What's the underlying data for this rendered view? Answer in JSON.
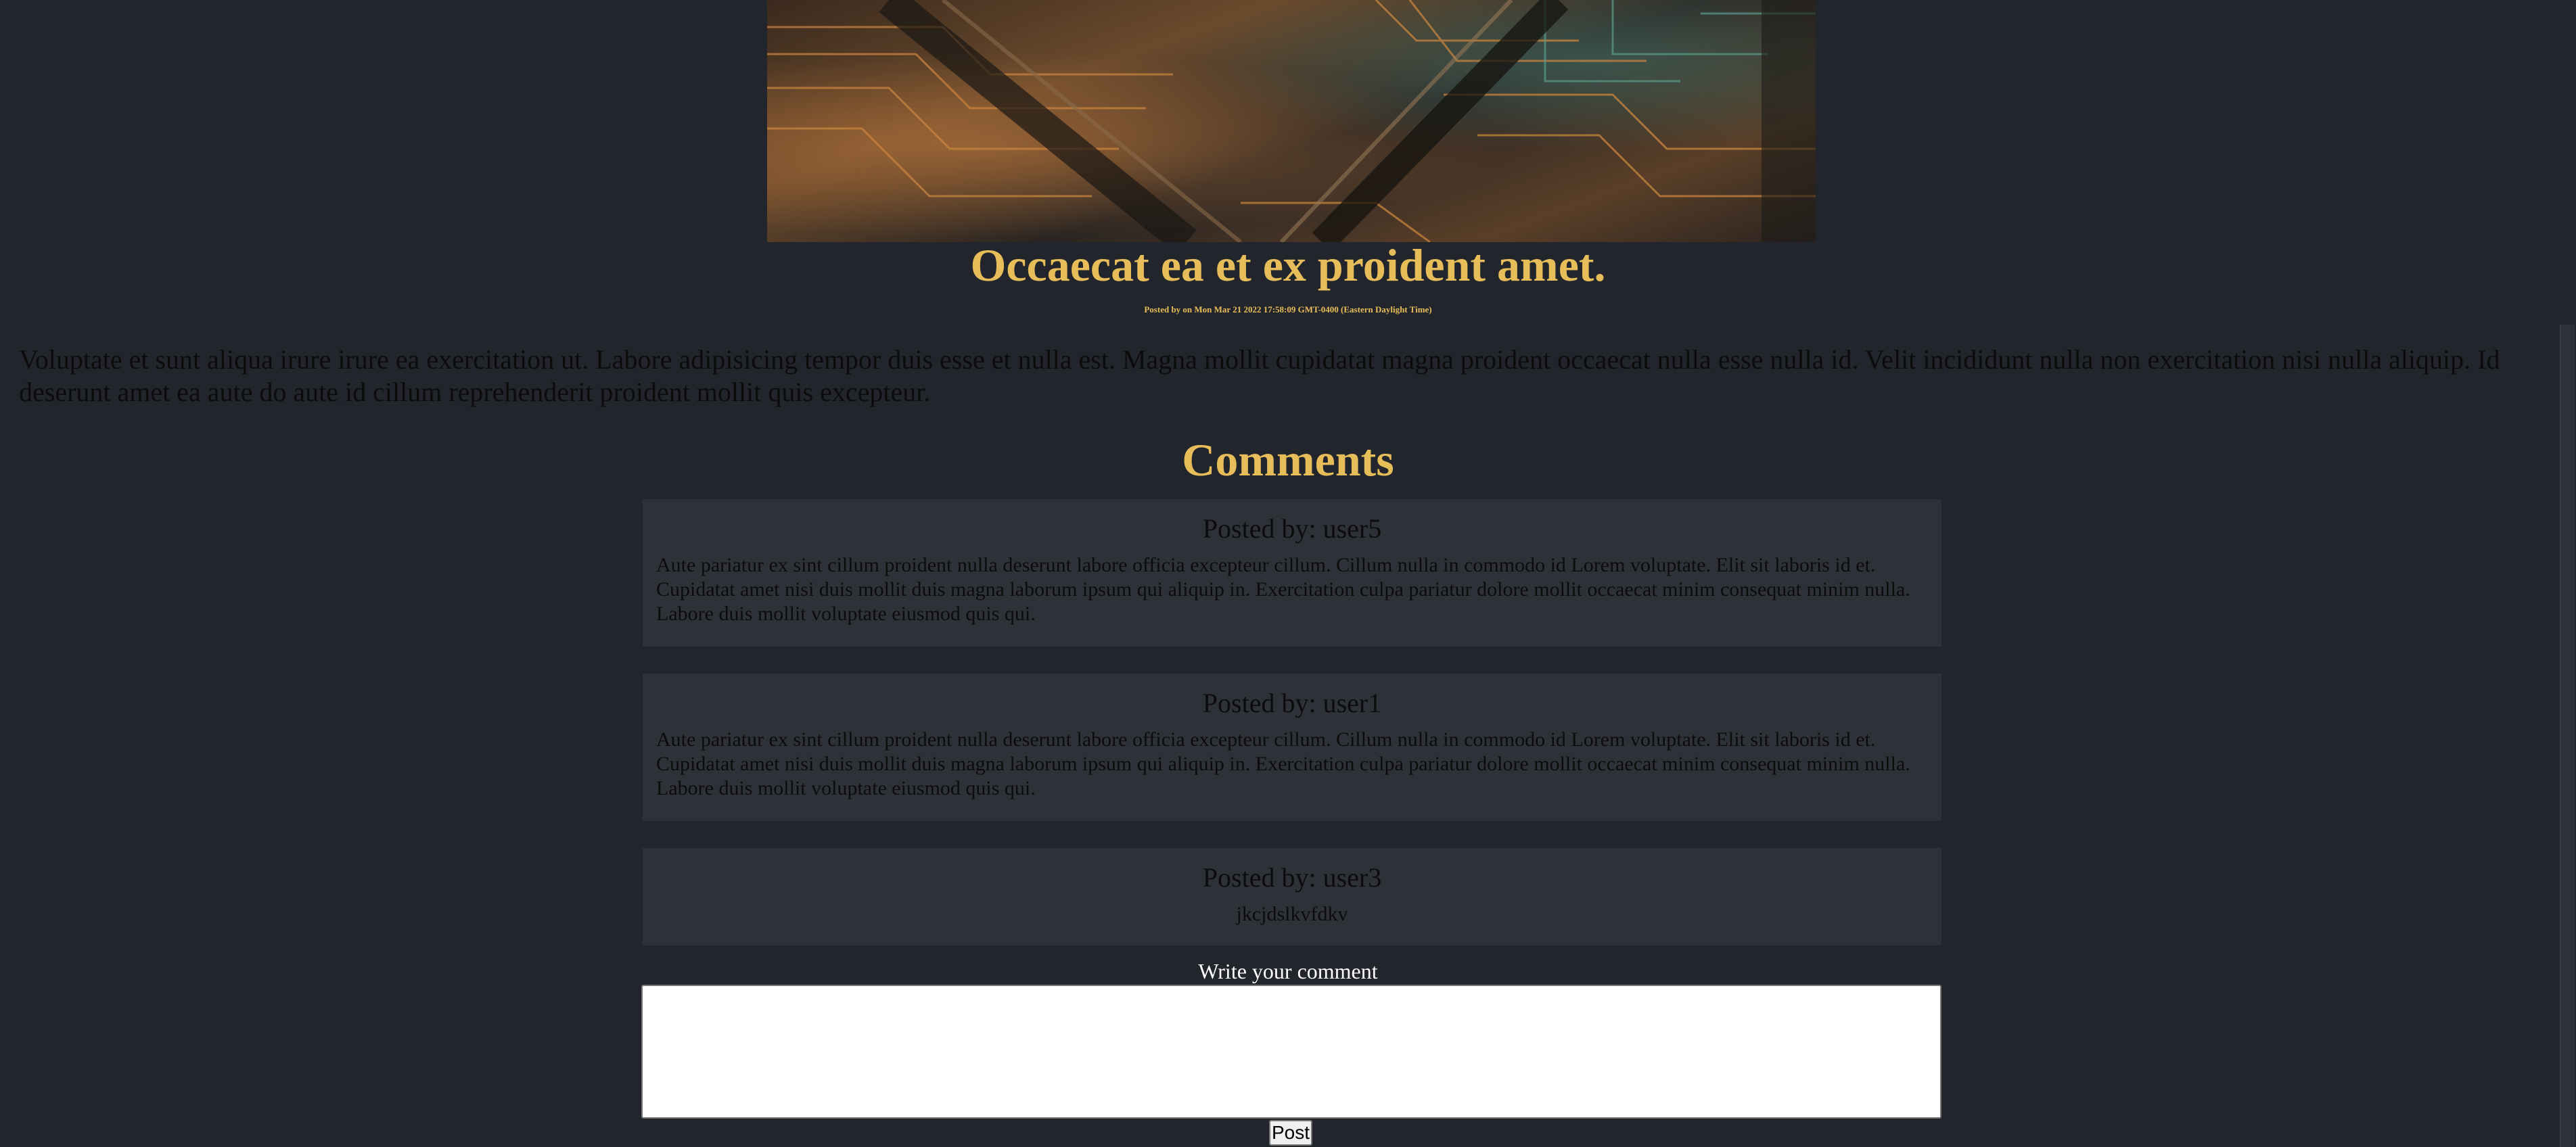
{
  "post": {
    "image_name": "circuit-board-image",
    "title": "Occaecat ea et ex proident amet.",
    "meta": "Posted by on Mon Mar 21 2022 17:58:09 GMT-0400 (Eastern Daylight Time)",
    "body": "Voluptate et sunt aliqua irure irure ea exercitation ut. Labore adipisicing tempor duis esse et nulla est. Magna mollit cupidatat magna proident occaecat nulla esse nulla id. Velit incididunt nulla non exercitation nisi nulla aliquip. Id deserunt amet ea aute do aute id cillum reprehenderit proident mollit quis excepteur."
  },
  "comments": {
    "heading": "Comments",
    "items": [
      {
        "author": "Posted by: user5",
        "text": "Aute pariatur ex sint cillum proident nulla deserunt labore officia excepteur cillum. Cillum nulla in commodo id Lorem voluptate. Elit sit laboris id et. Cupidatat amet nisi duis mollit duis magna laborum ipsum qui aliquip in. Exercitation culpa pariatur dolore mollit occaecat minim consequat minim nulla. Labore duis mollit voluptate eiusmod quis qui."
      },
      {
        "author": "Posted by: user1",
        "text": "Aute pariatur ex sint cillum proident nulla deserunt labore officia excepteur cillum. Cillum nulla in commodo id Lorem voluptate. Elit sit laboris id et. Cupidatat amet nisi duis mollit duis magna laborum ipsum qui aliquip in. Exercitation culpa pariatur dolore mollit occaecat minim consequat minim nulla. Labore duis mollit voluptate eiusmod quis qui."
      },
      {
        "author": "Posted by: user3",
        "text": "jkcjdslkvfdkv"
      }
    ]
  },
  "form": {
    "label": "Write your comment",
    "input_value": "",
    "button_label": "Post"
  },
  "colors": {
    "background": "#22252c",
    "accent": "#e7bd5a",
    "card": "#2e3138"
  }
}
